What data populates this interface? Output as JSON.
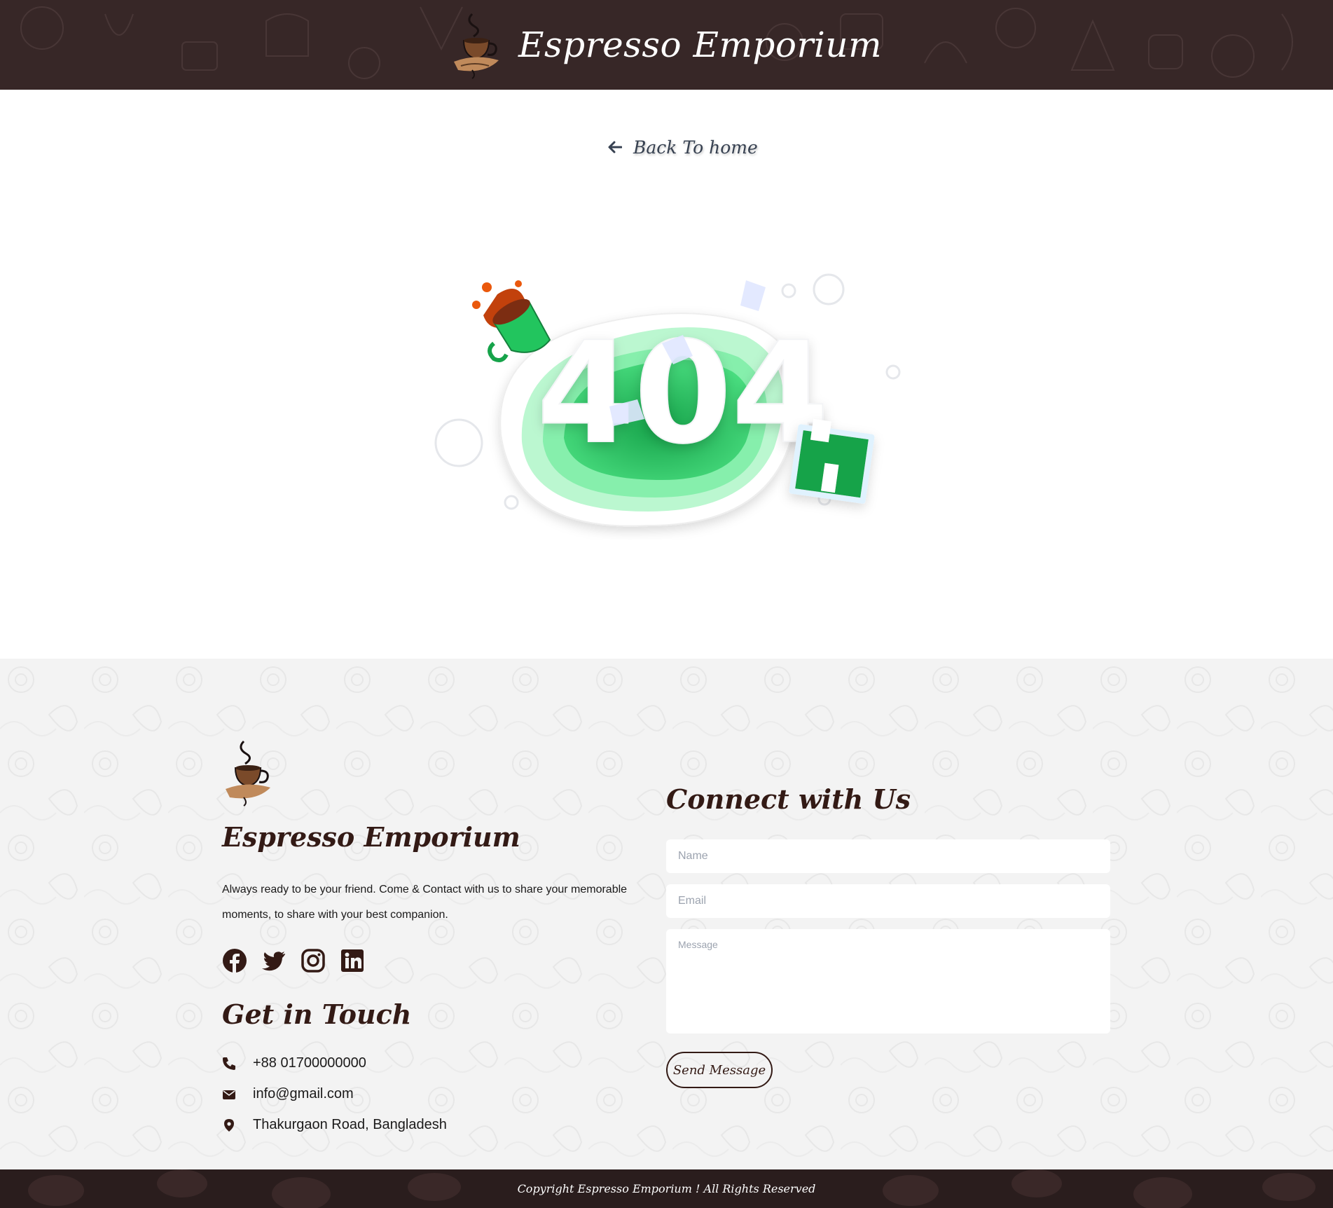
{
  "header": {
    "brand_title": "Espresso Emporium",
    "logo_icon": "coffee-cup-logo",
    "background": "#372727"
  },
  "main": {
    "back_link": {
      "label": "Back To home",
      "icon": "arrow-left-icon"
    },
    "error_code": "404",
    "illustration": "404-paper-cut-illustration"
  },
  "footer": {
    "brand_title": "Espresso Emporium",
    "description": "Always ready to be your friend. Come & Contact with us to share your memorable moments, to share with your best companion.",
    "socials": [
      {
        "name": "facebook",
        "icon": "facebook-icon"
      },
      {
        "name": "twitter",
        "icon": "twitter-icon"
      },
      {
        "name": "instagram",
        "icon": "instagram-icon"
      },
      {
        "name": "linkedin",
        "icon": "linkedin-icon"
      }
    ],
    "get_in_touch_title": "Get in Touch",
    "contacts": {
      "phone": "+88 01700000000",
      "email": "info@gmail.com",
      "address": "Thakurgaon Road, Bangladesh"
    },
    "connect_title": "Connect with Us",
    "form": {
      "name_placeholder": "Name",
      "email_placeholder": "Email",
      "message_placeholder": "Message",
      "submit_label": "Send Message"
    }
  },
  "bottom_bar": {
    "copyright": "Copyright Espresso Emporium ! All Rights Reserved"
  },
  "colors": {
    "header_bg": "#372727",
    "accent_dark": "#331a15",
    "footer_bg": "#f3f3f3",
    "illustration_green": "#22c55e"
  }
}
